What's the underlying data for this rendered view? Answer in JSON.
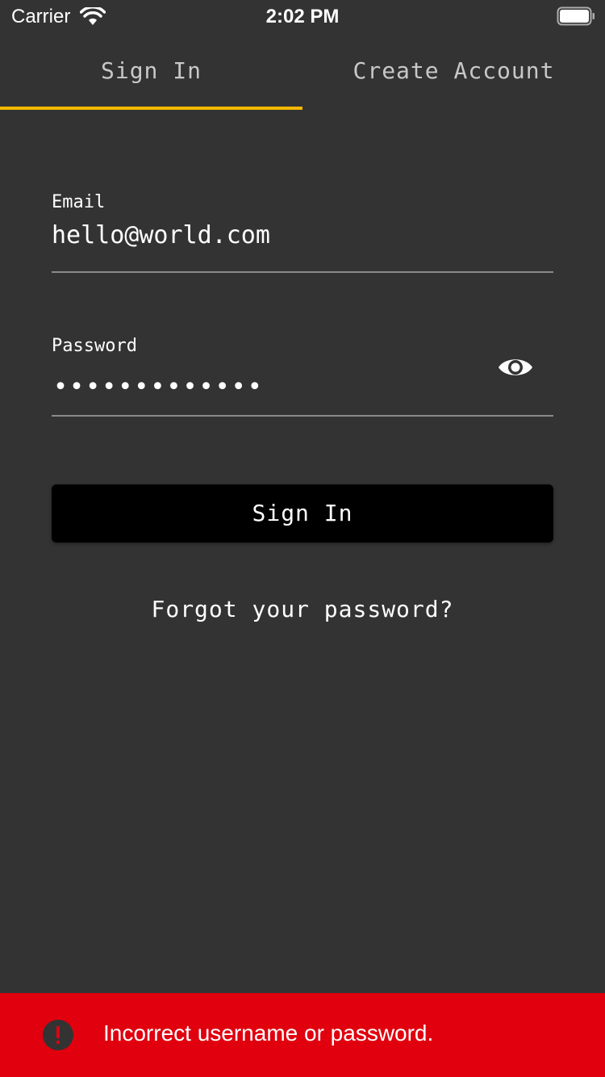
{
  "status_bar": {
    "carrier": "Carrier",
    "time": "2:02 PM",
    "icons": [
      "wifi-icon",
      "battery-icon"
    ]
  },
  "tabs": [
    {
      "label": "Sign In",
      "active": true
    },
    {
      "label": "Create Account",
      "active": false
    }
  ],
  "form": {
    "email": {
      "label": "Email",
      "value": "hello@world.com"
    },
    "password": {
      "label": "Password",
      "masked_value": "•••••••••••••",
      "toggle_icon": "eye-icon"
    },
    "submit_label": "Sign In",
    "forgot_label": "Forgot your password?"
  },
  "error": {
    "icon": "alert-icon",
    "message": "Incorrect username or password."
  },
  "colors": {
    "background": "#333333",
    "accent": "#f5b800",
    "button": "#000000",
    "error": "#e0000e"
  }
}
